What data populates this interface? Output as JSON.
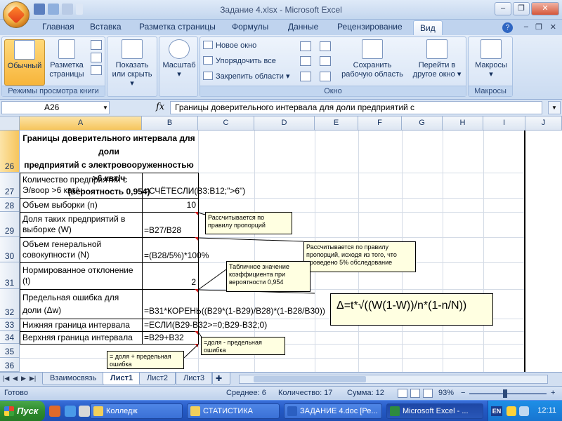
{
  "window": {
    "title": "Задание 4.xlsx - Microsoft Excel"
  },
  "ribbon": {
    "tabs": [
      "Главная",
      "Вставка",
      "Разметка страницы",
      "Формулы",
      "Данные",
      "Рецензирование",
      "Вид"
    ],
    "active_tab": "Вид",
    "groups": {
      "views": {
        "label": "Режимы просмотра книги",
        "normal": "Обычный",
        "page_layout_1": "Разметка",
        "page_layout_2": "страницы"
      },
      "show": {
        "label_1": "Показать",
        "label_2": "или скрыть"
      },
      "zoom": {
        "label": "Масштаб"
      },
      "window": {
        "label": "Окно",
        "new_window": "Новое окно",
        "arrange_all": "Упорядочить все",
        "freeze": "Закрепить области",
        "save_ws_1": "Сохранить",
        "save_ws_2": "рабочую область",
        "switch_1": "Перейти в",
        "switch_2": "другое окно"
      },
      "macros": {
        "label": "Макросы",
        "button": "Макросы"
      }
    }
  },
  "formula_bar": {
    "name_box": "A26",
    "fx": "fx",
    "content": "Границы доверительного интервала для доли предприятий с"
  },
  "grid": {
    "columns": [
      "A",
      "B",
      "C",
      "D",
      "E",
      "F",
      "G",
      "H",
      "I",
      "J"
    ],
    "selected_column": "A",
    "rows": [
      "26",
      "27",
      "28",
      "29",
      "30",
      "31",
      "32",
      "33",
      "34",
      "35",
      "36"
    ],
    "selected_row": "26",
    "title_lines": [
      "Границы доверительного интервала для доли",
      "предприятий с электровооруженностью >6 квт/ч",
      "(вероятность 0,954)"
    ],
    "cells": {
      "a27_1": "Количество предприятий с",
      "a27_2": "Э/воор >6 квт/ч",
      "b27": "=СЧЁТЕСЛИ(B3:B12;\">6\")",
      "a28": "Объем выборки (n)",
      "b28": "10",
      "a29_1": "Доля таких предприятий в",
      "a29_2": "выборке (W)",
      "b29": "=B27/B28",
      "a30_1": "Объем генеральной",
      "a30_2": "совокупности (N)",
      "b30": "=(B28/5%)*100%",
      "a31_1": "Нормированное отклонение",
      "a31_2": "(t)",
      "b31": "2",
      "a32_1": "Предельная ошибка для",
      "a32_2": "доли (Δw)",
      "b32": "=B31*КОРЕНЬ((B29*(1-B29)/B28)*(1-B28/B30))",
      "a33": "Нижняя граница интервала",
      "b33": "=ЕСЛИ(B29-B32>=0;B29-B32;0)",
      "a34": "Верхняя граница интервала",
      "b34": "=B29+B32"
    },
    "comments": {
      "c1": "Рассчитывается по правилу пропорций",
      "c2": "Рассчитывается по правилу пропорций, исходя из того, что проведено 5% обследование",
      "c3": "Табличное значение коэффициента при вероятности 0,954",
      "c4": "=доля - предельная ошибка",
      "c5": "= доля + предельная ошибка"
    },
    "formula_note": "Δ=t*√((W(1-W))/n*(1-n/N))"
  },
  "sheets": {
    "tabs": [
      "Взаимосвязь",
      "Лист1",
      "Лист2",
      "Лист3"
    ],
    "active": "Лист1"
  },
  "status": {
    "ready": "Готово",
    "average": "Среднее: 6",
    "count": "Количество: 17",
    "sum": "Сумма: 12",
    "zoom": "93%",
    "zoom_fraction": 0.465
  },
  "taskbar": {
    "start": "Пуск",
    "tasks": [
      "Колледж",
      "СТАТИСТИКА",
      "ЗАДАНИЕ 4.doc [Ре...",
      "Microsoft Excel - ..."
    ],
    "active_task": "Microsoft Excel - ...",
    "lang": "EN",
    "clock": "12:11"
  }
}
